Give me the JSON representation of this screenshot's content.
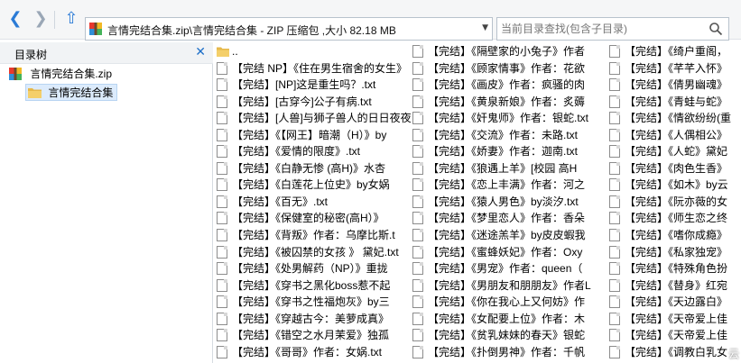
{
  "toolbar": {
    "address_path": "言情完结合集.zip\\言情完结合集 - ZIP 压缩包 ,大小 82.18 MB",
    "search_placeholder": "当前目录查找(包含子目录)"
  },
  "sidebar": {
    "title": "目录树",
    "root": "言情完结合集.zip",
    "child": "言情完结合集"
  },
  "files": {
    "col0": [
      "..",
      "【完结 NP】《住在男生宿舍的女生》",
      "【完结】[NP]这是重生吗？.txt",
      "【完结】[古穿今]公子有病.txt",
      "【完结】[人兽]与狮子兽人的日日夜夜",
      "【完结】《【网王】暗潮（H）》by",
      "【完结】《爱情的限度》.txt",
      "【完结】《白静无惨 (高H)》水杏",
      "【完结】《白莲花上位史》by女娲",
      "【完结】《百无》.txt",
      "【完结】《保健室的秘密(高H）》",
      "【完结】《背叛》作者：乌摩比斯.t",
      "【完结】《被囚禁的女孩 》 黛妃.txt",
      "【完结】《处男解药（NP）》重拢",
      "【完结】《穿书之黑化boss惹不起",
      "【完结】《穿书之性福炮灰》by三",
      "【完结】《穿越古今：美萝成真》",
      "【完结】《错空之水月茉爱》独孤",
      "【完结】《哥哥》作者：女娲.txt"
    ],
    "col1": [
      "【完结】《隔壁家的小兔子》作者",
      "【完结】《顾家情事》作者：花欲",
      "【完结】《画皮》作者：疯骚的肉",
      "【完结】《黄泉新娘》作者：炙薅",
      "【完结】《奸鬼师》作者：银蛇.txt",
      "【完结】《交流》作者：未路.txt",
      "【完结】《娇妻》作者：迦南.txt",
      "【完结】《狼遇上羊》[校园 高H",
      "【完结】《恋上丰满》作者：河之",
      "【完结】《猿人男色》by淡汐.txt",
      "【完结】《梦里恋人》作者：香朵",
      "【完结】《迷途羔羊》by皮皮蝦我",
      "【完结】《蜜蜂妖妃》作者：Oxy",
      "【完结】《男宠》作者：queen（",
      "【完结】《男朋友和朋朋友》作者L",
      "【完结】《你在我心上又何妨》作",
      "【完结】《女配要上位》作者：木",
      "【完结】《贫乳妹妹的春天》银蛇",
      "【完结】《扑倒男神》作者：千帆"
    ],
    "col2": [
      "【完结】《绮户重阁，",
      "【完结】《芊芊入怀》",
      "【完结】《倩男幽魂》",
      "【完结】《青蛙与蛇》",
      "【完结】《情欲纷纷(重",
      "【完结】《人偶相公》",
      "【完结】《人蛇》黛妃",
      "【完结】《肉色生香》",
      "【完结】《如木》by云",
      "【完结】《阮亦薇的女",
      "【完结】《师生恋之终",
      "【完结】《嗜你成瘾》",
      "【完结】《私家独宠》",
      "【完结】《特殊角色扮",
      "【完结】《替身》红宛",
      "【完结】《天边露白》",
      "【完结】《天帝爱上佳",
      "【完结】《天帝爱上佳",
      "【完结】《调教白乳女"
    ]
  },
  "watermark": "云"
}
